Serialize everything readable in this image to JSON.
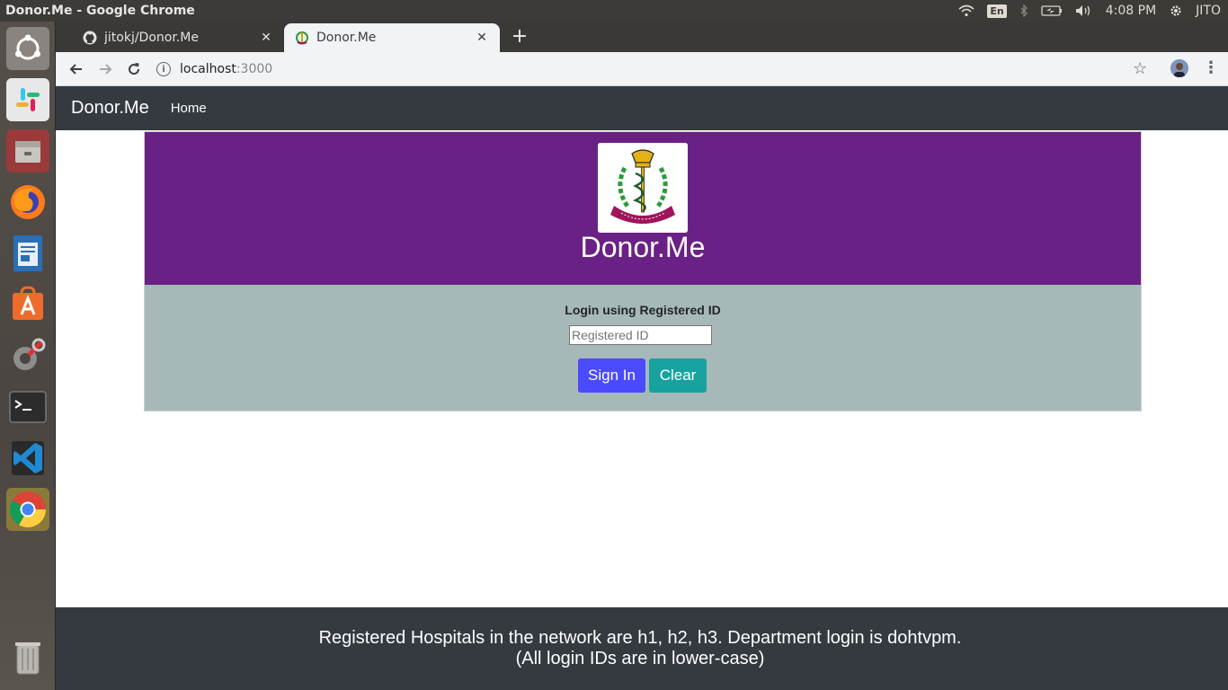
{
  "system": {
    "window_title": "Donor.Me - Google Chrome",
    "keyboard_layout": "En",
    "clock": "4:08 PM",
    "user": "JITO"
  },
  "launcher": {
    "items": [
      {
        "name": "ubuntu-dash-icon"
      },
      {
        "name": "slack-icon"
      },
      {
        "name": "files-icon"
      },
      {
        "name": "firefox-icon"
      },
      {
        "name": "libreoffice-writer-icon"
      },
      {
        "name": "software-center-icon"
      },
      {
        "name": "system-settings-icon"
      },
      {
        "name": "terminal-icon"
      },
      {
        "name": "vscode-icon"
      },
      {
        "name": "chrome-icon"
      },
      {
        "name": "trash-icon"
      }
    ]
  },
  "browser": {
    "tabs": [
      {
        "label": "jitokj/Donor.Me",
        "icon": "github-icon",
        "active": false
      },
      {
        "label": "Donor.Me",
        "icon": "ima-logo-icon",
        "active": true
      }
    ],
    "new_tab": "+",
    "url_host": "localhost",
    "url_port": ":3000"
  },
  "site": {
    "brand": "Donor.Me",
    "nav_home": "Home",
    "hero_title": "Donor.Me",
    "login_label": "Login using Registered ID",
    "login_placeholder": "Registered ID",
    "login_value": "",
    "signin_label": "Sign In",
    "clear_label": "Clear",
    "footer_line1": "Registered Hospitals in the network are h1, h2, h3. Department login is dohtvpm.",
    "footer_line2": "(All login IDs are in lower-case)"
  },
  "colors": {
    "navbar": "#343a40",
    "hero": "#6a2185",
    "login_bg": "#a7b8b8",
    "signin": "#4a4aff",
    "clear": "#17a2a0"
  }
}
